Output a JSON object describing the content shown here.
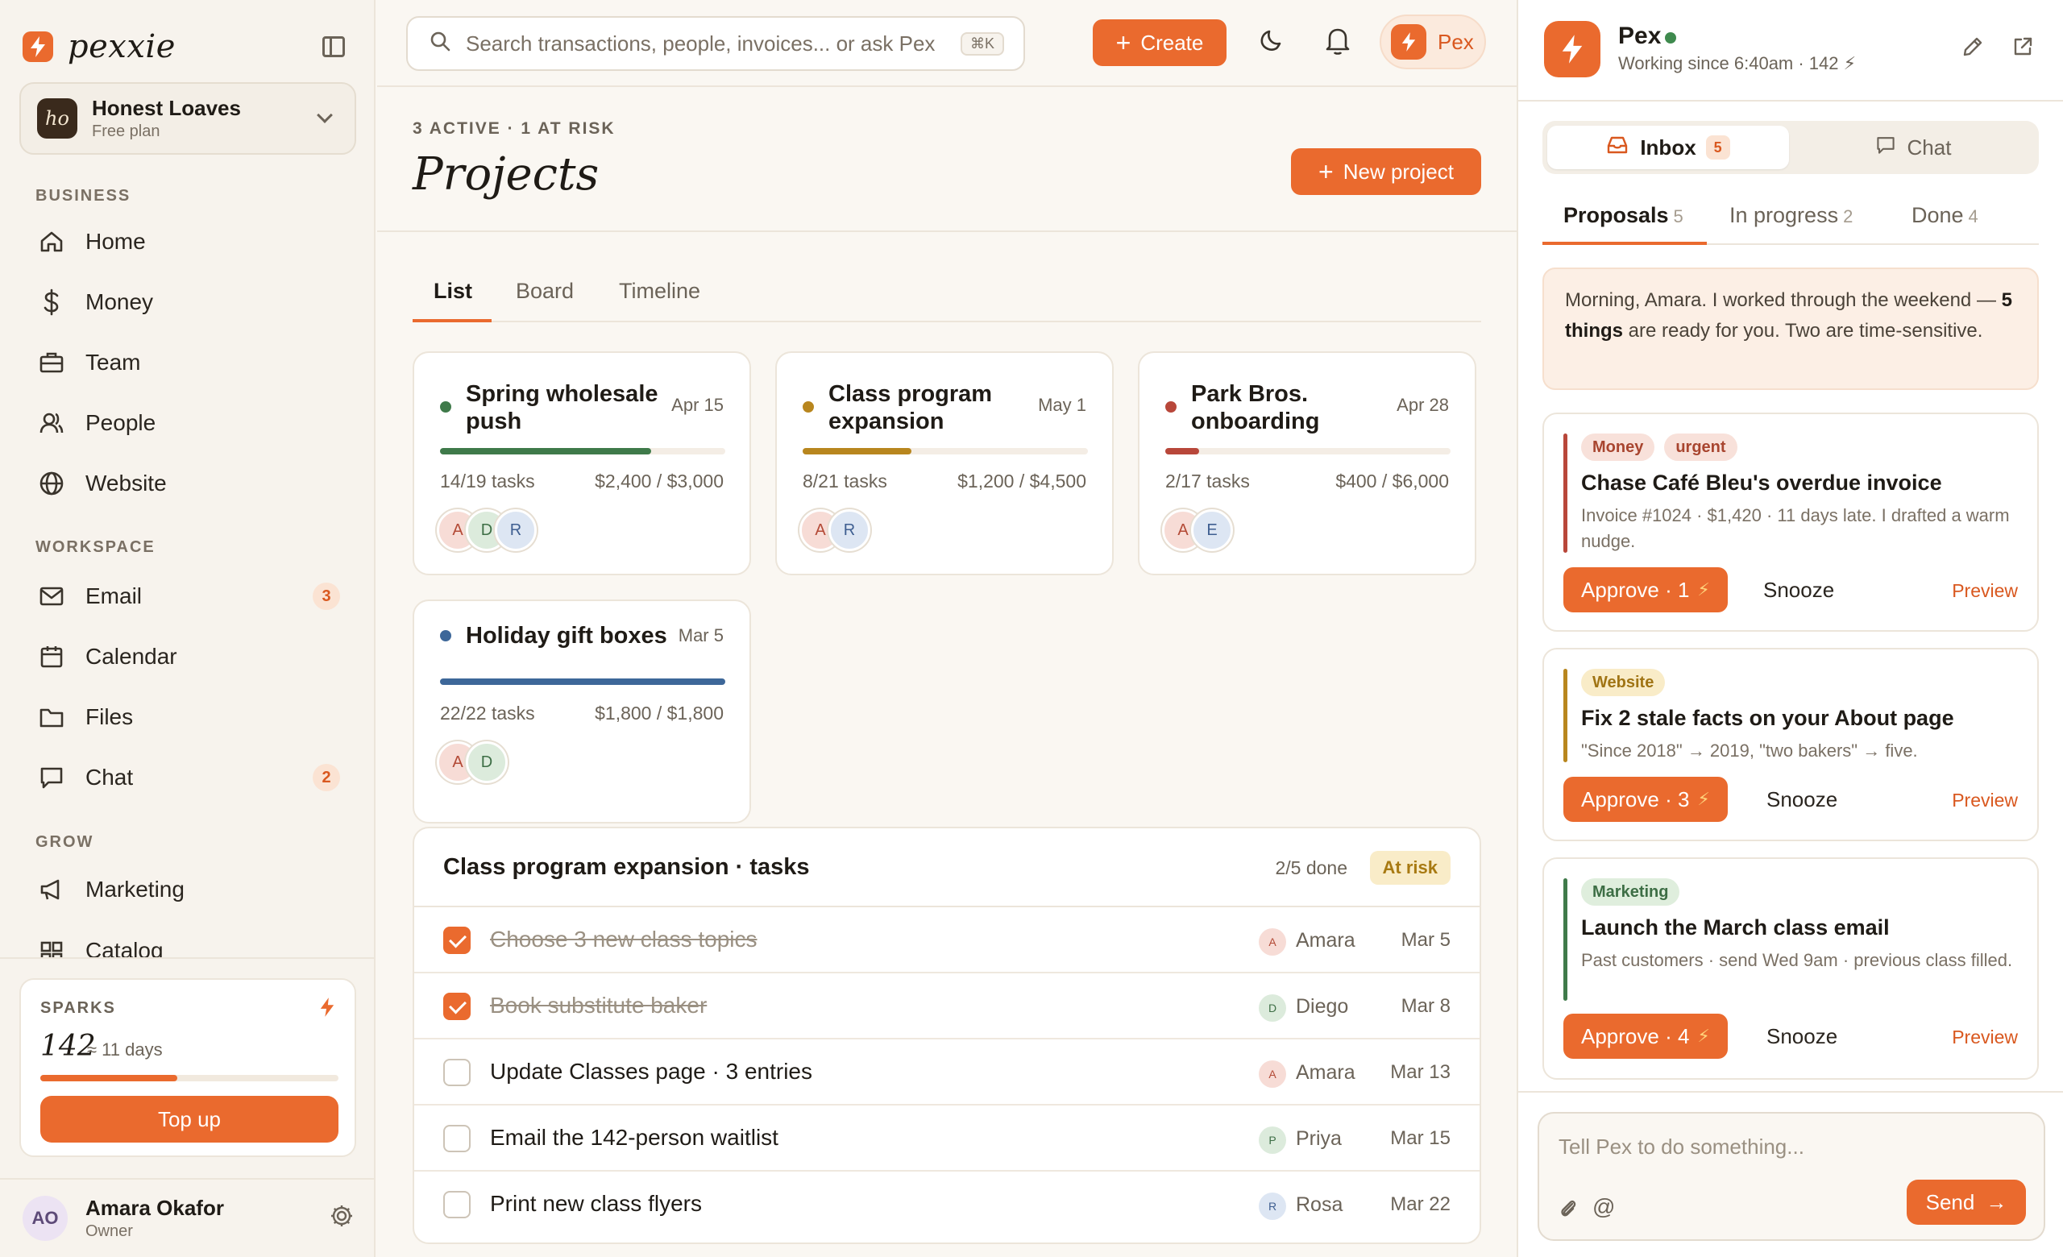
{
  "app": {
    "name": "pexxie",
    "accent": "#ea6a2e"
  },
  "org": {
    "initials": "ho",
    "name": "Honest Loaves",
    "plan": "Free plan"
  },
  "sidebar": {
    "sections": {
      "business": "BUSINESS",
      "workspace": "WORKSPACE",
      "grow": "GROW"
    },
    "items": [
      {
        "label": "Home",
        "icon": "home-icon"
      },
      {
        "label": "Money",
        "icon": "dollar-icon"
      },
      {
        "label": "Team",
        "icon": "briefcase-icon"
      },
      {
        "label": "People",
        "icon": "people-icon"
      },
      {
        "label": "Website",
        "icon": "globe-icon"
      },
      {
        "label": "Email",
        "icon": "mail-icon",
        "badge": "3"
      },
      {
        "label": "Calendar",
        "icon": "calendar-icon"
      },
      {
        "label": "Files",
        "icon": "folder-icon"
      },
      {
        "label": "Chat",
        "icon": "chat-icon",
        "badge": "2"
      },
      {
        "label": "Marketing",
        "icon": "megaphone-icon"
      },
      {
        "label": "Catalog",
        "icon": "grid-icon"
      }
    ]
  },
  "sparks": {
    "label": "SPARKS",
    "count": "142",
    "days": "≈ 11 days",
    "level": 0.46,
    "topup": "Top up"
  },
  "user": {
    "initials": "AO",
    "name": "Amara Okafor",
    "role": "Owner"
  },
  "topbar": {
    "search_placeholder": "Search transactions, people, invoices... or ask Pex",
    "shortcut": "⌘K",
    "create": "Create",
    "pex": "Pex"
  },
  "main": {
    "eyebrow": "3 ACTIVE · 1 AT RISK",
    "title": "Projects",
    "new_project": "New project",
    "tabs": [
      "List",
      "Board",
      "Timeline"
    ]
  },
  "projects": [
    {
      "title": "Spring wholesale push",
      "date": "Apr 15",
      "tasks": "14/19 tasks",
      "money": "$2,400 / $3,000",
      "progress": 0.74,
      "color": "#3f7a4a",
      "avatars": [
        "A",
        "D",
        "R"
      ]
    },
    {
      "title": "Class program expansion",
      "date": "May 1",
      "tasks": "8/21 tasks",
      "money": "$1,200 / $4,500",
      "progress": 0.38,
      "color": "#b8861e",
      "avatars": [
        "A",
        "R"
      ]
    },
    {
      "title": "Park Bros. onboarding",
      "date": "Apr 28",
      "tasks": "2/17 tasks",
      "money": "$400 / $6,000",
      "progress": 0.12,
      "color": "#b8473a",
      "avatars": [
        "A",
        "E"
      ]
    },
    {
      "title": "Holiday gift boxes",
      "date": "Mar 5",
      "tasks": "22/22 tasks",
      "money": "$1,800 / $1,800",
      "progress": 1.0,
      "color": "#3d6799",
      "avatars": [
        "A",
        "D"
      ]
    }
  ],
  "task_panel": {
    "title": "Class program expansion · tasks",
    "done": "2/5 done",
    "badge": "At risk",
    "rows": [
      {
        "label": "Choose 3 new class topics",
        "done": true,
        "initial": "A",
        "who": "Amara",
        "due": "Mar 5"
      },
      {
        "label": "Book substitute baker",
        "done": true,
        "initial": "D",
        "who": "Diego",
        "due": "Mar 8"
      },
      {
        "label": "Update Classes page · 3 entries",
        "done": false,
        "initial": "A",
        "who": "Amara",
        "due": "Mar 13"
      },
      {
        "label": "Email the 142-person waitlist",
        "done": false,
        "initial": "P",
        "who": "Priya",
        "due": "Mar 15"
      },
      {
        "label": "Print new class flyers",
        "done": false,
        "initial": "R",
        "who": "Rosa",
        "due": "Mar 22"
      }
    ]
  },
  "pex": {
    "name": "Pex",
    "sub": "Working since 6:40am · 142 ⚡",
    "seg": {
      "inbox": "Inbox",
      "inbox_count": "5",
      "chat": "Chat"
    },
    "subtabs": [
      {
        "label": "Proposals",
        "n": "5"
      },
      {
        "label": "In progress",
        "n": "2"
      },
      {
        "label": "Done",
        "n": "4"
      }
    ],
    "greeting": {
      "pre": "Morning, Amara. I worked through the weekend — ",
      "bold": "5 things",
      "post": " are ready for you. Two are time-sensitive."
    },
    "proposals": [
      {
        "tags": [
          "Money",
          "urgent"
        ],
        "title": "Chase Café Bleu's overdue invoice",
        "desc": "Invoice #1024 · $1,420 · 11 days late. I drafted a warm nudge.",
        "approve": "Approve · 1",
        "snooze": "Snooze",
        "preview": "Preview",
        "bar": "#b8473a"
      },
      {
        "tags": [
          "Website"
        ],
        "title": "Fix 2 stale facts on your About page",
        "desc": "\"Since 2018\" → 2019, \"two bakers\" → five.",
        "approve": "Approve · 3",
        "snooze": "Snooze",
        "preview": "Preview",
        "bar": "#b8861e"
      },
      {
        "tags": [
          "Marketing"
        ],
        "title": "Launch the March class email",
        "desc": "Past customers · send Wed 9am · previous class filled.",
        "approve": "Approve · 4",
        "snooze": "Snooze",
        "preview": "Preview",
        "bar": "#3f7a4a"
      }
    ],
    "composer_placeholder": "Tell Pex to do something...",
    "composer_at": "@",
    "send": "Send"
  }
}
